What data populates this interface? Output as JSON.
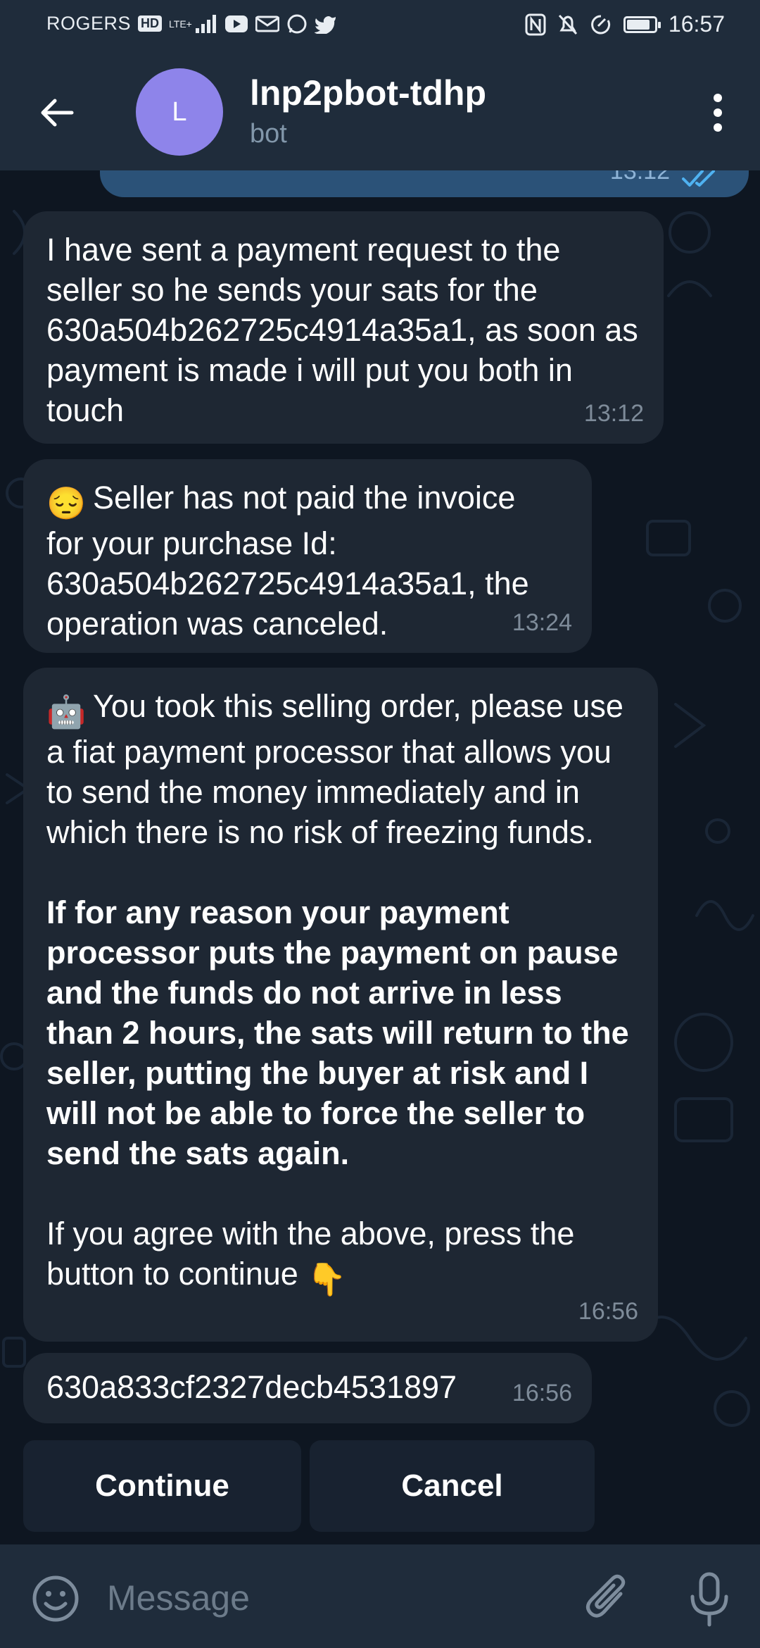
{
  "status_bar": {
    "carrier": "ROGERS",
    "hd": "HD",
    "network": "LTE+",
    "time": "16:57",
    "battery_level": 0.85
  },
  "header": {
    "title": "lnp2pbot-tdhp",
    "subtitle": "bot",
    "avatar_letter": "L",
    "avatar_color": "#8e84ea"
  },
  "messages": {
    "outgoing_time": "13:12",
    "m1": {
      "text": "I have sent a payment request to the seller so he sends your sats for the 630a504b262725c4914a35a1, as soon as payment is made i will put you both in touch",
      "time": "13:12"
    },
    "m2": {
      "emoji": "😔",
      "text": "Seller has not paid the invoice for your purchase Id: 630a504b262725c4914a35a1, the operation was canceled.",
      "time": "13:24"
    },
    "m3": {
      "emoji": "🤖",
      "text_intro": "You took this selling order, please use a fiat payment processor that allows you to send the money immediately and in which there is no risk of freezing funds.",
      "text_warning": "If for any reason your payment processor puts the payment on pause and the funds do not arrive in less than 2 hours, the sats will return to the seller, putting the buyer at risk and I will not be able to force the seller to send the sats again.",
      "text_outro": "If you agree with the above, press the button to continue",
      "outro_emoji": "👇",
      "time": "16:56"
    },
    "m4": {
      "text": "630a833cf2327decb4531897",
      "time": "16:56"
    }
  },
  "keyboard": {
    "continue_label": "Continue",
    "cancel_label": "Cancel"
  },
  "input": {
    "placeholder": "Message"
  },
  "icons": {
    "back": "arrow-left-icon",
    "more": "more-vertical-icon",
    "emoji": "smiley-icon",
    "attach": "paperclip-icon",
    "mic": "microphone-icon"
  },
  "colors": {
    "background": "#0e1621",
    "header": "#1f2c3b",
    "incoming_bubble": "#1e2733",
    "outgoing_bubble": "#2b5278",
    "keyboard_button": "#182230",
    "meta_text": "#7e8b99",
    "checks": "#4fb2f1"
  }
}
